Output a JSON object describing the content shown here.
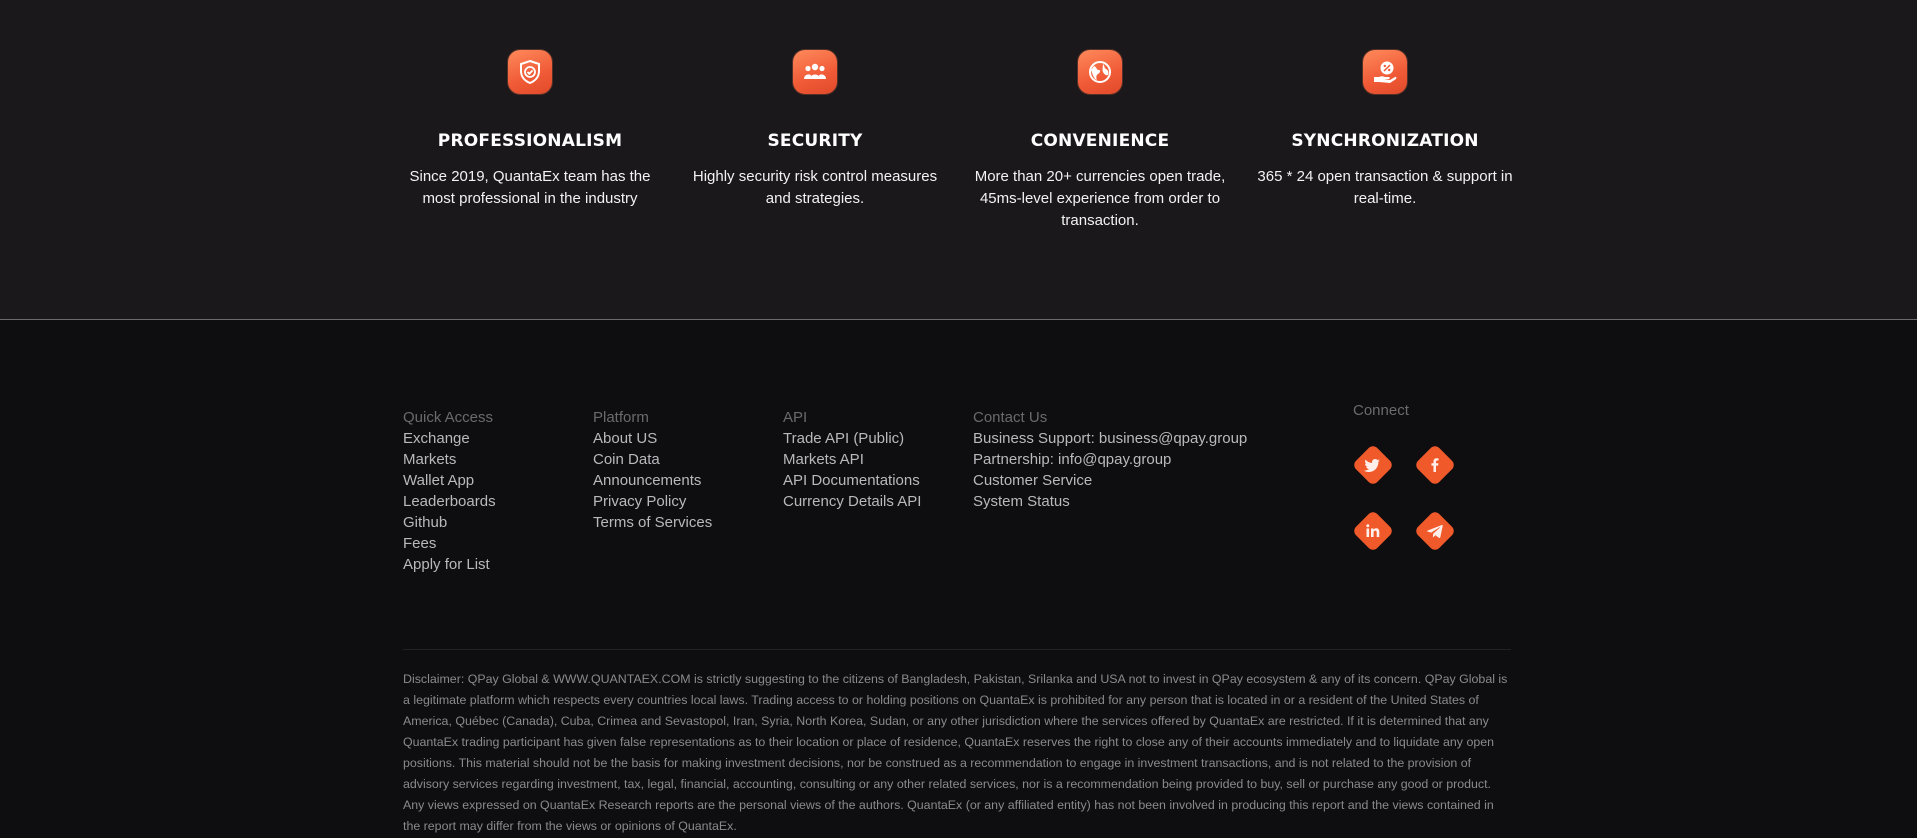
{
  "features": [
    {
      "icon": "shield-check-icon",
      "title": "PROFESSIONALISM",
      "text": "Since 2019, QuantaEx team has the most professional in the industry"
    },
    {
      "icon": "team-icon",
      "title": "SECURITY",
      "text": "Highly security risk control measures and strategies."
    },
    {
      "icon": "globe-icon",
      "title": "CONVENIENCE",
      "text": "More than 20+ currencies open trade, 45ms-level experience from order to transaction."
    },
    {
      "icon": "hand-percent-icon",
      "title": "SYNCHRONIZATION",
      "text": "365 * 24 open transaction & support in real-time."
    }
  ],
  "footer": {
    "quick_access": {
      "heading": "Quick Access",
      "links": [
        "Exchange",
        "Markets",
        "Wallet App",
        "Leaderboards",
        "Github",
        "Fees",
        "Apply for List"
      ]
    },
    "platform": {
      "heading": "Platform",
      "links": [
        "About US",
        "Coin Data",
        "Announcements",
        "Privacy Policy",
        "Terms of Services"
      ]
    },
    "api": {
      "heading": "API",
      "links": [
        "Trade API (Public)",
        "Markets API",
        "API Documentations",
        "Currency Details API"
      ]
    },
    "contact": {
      "heading": "Contact Us",
      "links": [
        "Business Support: business@qpay.group",
        "Partnership: info@qpay.group",
        "Customer Service",
        "System Status"
      ]
    },
    "connect": {
      "heading": "Connect",
      "socials": [
        "twitter-icon",
        "facebook-icon",
        "linkedin-icon",
        "telegram-icon"
      ]
    }
  },
  "disclaimer": "Disclaimer: QPay Global & WWW.QUANTAEX.COM is strictly suggesting to the citizens of Bangladesh, Pakistan, Srilanka and USA not to invest in QPay ecosystem & any of its concern. QPay Global is a legitimate platform which respects every countries local laws. Trading access to or holding positions on QuantaEx is prohibited for any person that is located in or a resident of the United States of America, Québec (Canada), Cuba, Crimea and Sevastopol, Iran, Syria, North Korea, Sudan, or any other jurisdiction where the services offered by QuantaEx are restricted. If it is determined that any QuantaEx trading participant has given false representations as to their location or place of residence, QuantaEx reserves the right to close any of their accounts immediately and to liquidate any open positions. This material should not be the basis for making investment decisions, nor be construed as a recommendation to engage in investment transactions, and is not related to the provision of advisory services regarding investment, tax, legal, financial, accounting, consulting or any other related services, nor is a recommendation being provided to buy, sell or purchase any good or product. Any views expressed on QuantaEx Research reports are the personal views of the authors. QuantaEx (or any affiliated entity) has not been involved in producing this report and the views contained in the report may differ from the views or opinions of QuantaEx.",
  "colors": {
    "accent": "#f05a2b",
    "features_bg": "#1a181b",
    "footer_bg": "#0e0d10"
  }
}
